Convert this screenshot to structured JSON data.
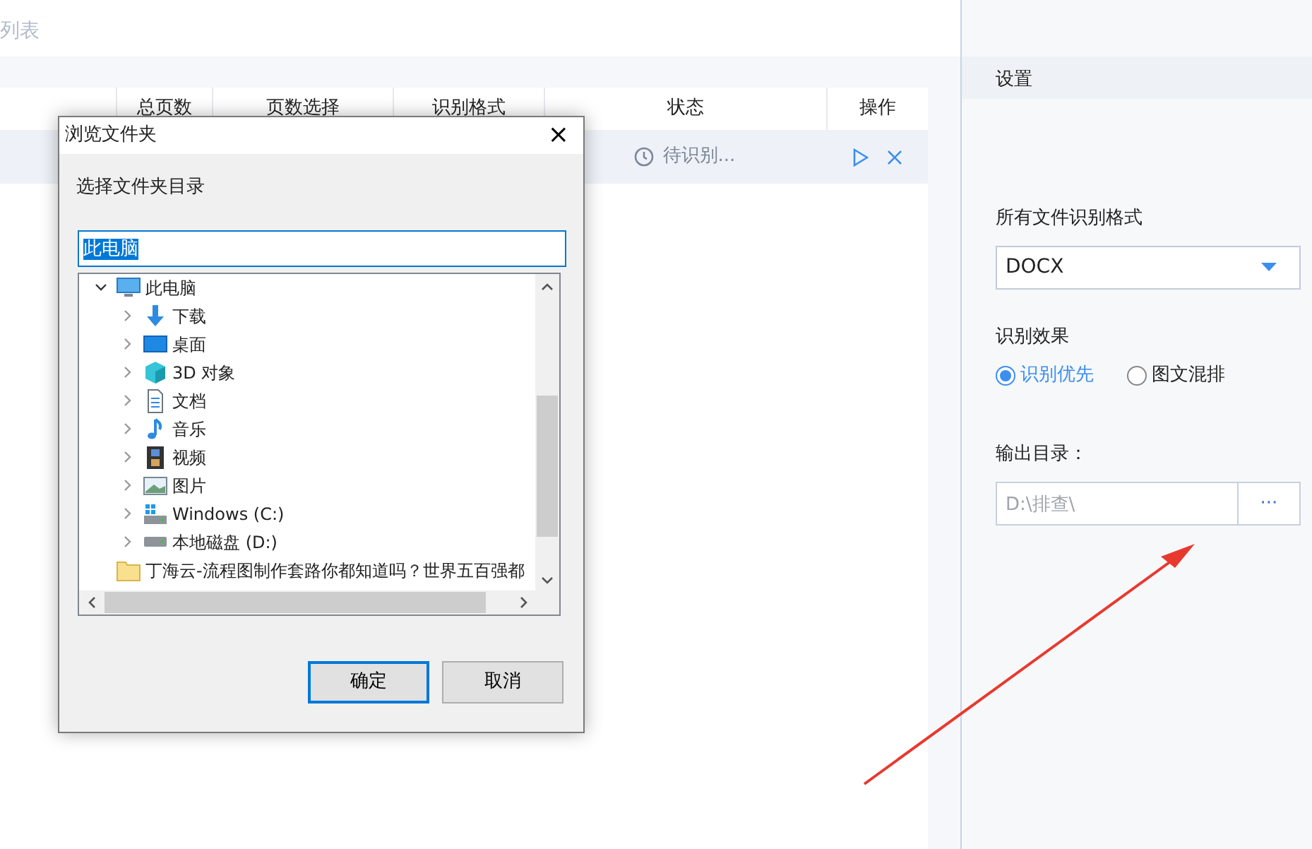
{
  "page": {
    "title": "列表"
  },
  "table": {
    "columns": [
      "总页数",
      "页数选择",
      "识别格式",
      "状态",
      "操作"
    ],
    "rows": [
      {
        "status": "待识别...",
        "actions": [
          {
            "kind": "start"
          },
          {
            "kind": "remove"
          }
        ]
      }
    ]
  },
  "settings": {
    "title": "设置",
    "format_label": "所有文件识别格式",
    "format_value": "DOCX",
    "effect_label": "识别效果",
    "effect_options": [
      {
        "label": "识别优先",
        "selected": true
      },
      {
        "label": "图文混排",
        "selected": false
      }
    ],
    "output_label": "输出目录：",
    "output_value": "D:\\排查\\",
    "output_readonly": true,
    "browse_button": "···"
  },
  "dialog": {
    "title": "浏览文件夹",
    "close": "×",
    "prompt": "选择文件夹目录",
    "folder_field": {
      "value": "此电脑",
      "text_selected": true
    },
    "tree": [
      {
        "label": "此电脑",
        "kind": "computer",
        "expanded": true,
        "children": [
          {
            "label": "下载",
            "kind": "download",
            "expanded": false
          },
          {
            "label": "桌面",
            "kind": "desktop",
            "expanded": false
          },
          {
            "label": "3D 对象",
            "kind": "object3d",
            "expanded": false
          },
          {
            "label": "文档",
            "kind": "documents",
            "expanded": false
          },
          {
            "label": "音乐",
            "kind": "music",
            "expanded": false
          },
          {
            "label": "视频",
            "kind": "videos",
            "expanded": false
          },
          {
            "label": "图片",
            "kind": "pictures",
            "expanded": false
          },
          {
            "label": "Windows (C:)",
            "kind": "system-drive",
            "expanded": false
          },
          {
            "label": "本地磁盘 (D:)",
            "kind": "drive",
            "expanded": false
          }
        ]
      },
      {
        "label": "丁海云-流程图制作套路你都知道吗？世界五百强都",
        "kind": "folder"
      }
    ],
    "buttons": [
      {
        "label": "确定",
        "kind": "primary"
      },
      {
        "label": "取消",
        "kind": "secondary"
      }
    ]
  }
}
